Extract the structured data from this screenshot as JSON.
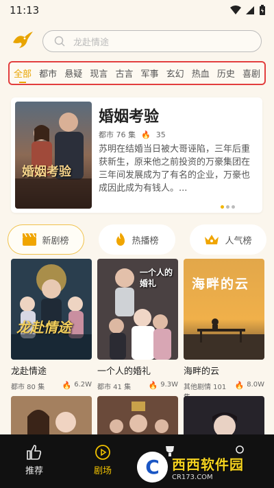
{
  "status": {
    "time": "11:13"
  },
  "search": {
    "placeholder": "龙赴情途"
  },
  "categories": [
    "全部",
    "都市",
    "悬疑",
    "现言",
    "古言",
    "军事",
    "玄幻",
    "热血",
    "历史",
    "喜剧"
  ],
  "banner": {
    "title": "婚姻考验",
    "meta": "都市 76 集",
    "hot": "35",
    "description": "苏明在结婚当日被大哥诬陷，三年后重获新生，原来他之前投资的万豪集团在三年间发展成为了有名的企业，万豪也成因此成为有钱人。...",
    "poster_text": "婚姻考验"
  },
  "rank_tabs": [
    "新剧榜",
    "热播榜",
    "人气榜"
  ],
  "dramas": [
    {
      "title": "龙赴情途",
      "meta": "都市 80 集",
      "hot": "6.2W",
      "poster_text": "龙赴情途"
    },
    {
      "title": "一个人的婚礼",
      "meta": "都市 41 集",
      "hot": "9.3W",
      "poster_text": "一个人的婚礼"
    },
    {
      "title": "海畔的云",
      "meta": "其他剧情 101 集",
      "hot": "8.0W",
      "poster_text": "海畔的云"
    }
  ],
  "nav": {
    "recommend": "推荐",
    "theater": "剧场"
  },
  "watermark": {
    "main": "西西软件园",
    "sub": "CR173.COM"
  },
  "colors": {
    "accent": "#e8a400",
    "highlight_border": "#e23d3d",
    "flame": "#e94e30"
  }
}
